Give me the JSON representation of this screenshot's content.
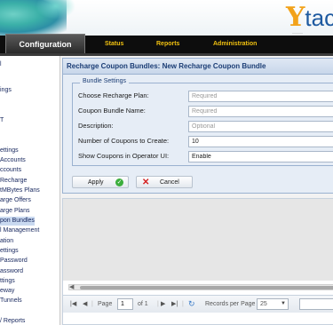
{
  "header": {
    "logo_y": "Y",
    "logo_rest": "tac",
    "logo_tagline": "———"
  },
  "topnav": {
    "tabs": [
      {
        "label": "Configuration",
        "active": true
      },
      {
        "label": "Status"
      },
      {
        "label": "Reports"
      },
      {
        "label": "Administration"
      }
    ]
  },
  "sidebar": {
    "items": [
      "l",
      "ings",
      "T",
      "ettings",
      " Accounts",
      "ccounts",
      "Recharge",
      "tMBytes Plans",
      "arge Offers",
      "arge Plans",
      "pon Bundles",
      "l Management",
      "ation",
      "ettings",
      "Password",
      "assword",
      "ttings",
      "eway",
      "Tunnels",
      "/ Reports"
    ],
    "selected_index": 10
  },
  "panel": {
    "title": "Recharge Coupon Bundles: New Recharge Coupon Bundle",
    "legend": "Bundle Settings",
    "fields": [
      {
        "label": "Choose Recharge Plan:",
        "value": "",
        "placeholder": "Required"
      },
      {
        "label": "Coupon Bundle Name:",
        "value": "",
        "placeholder": "Required"
      },
      {
        "label": "Description:",
        "value": "",
        "placeholder": "Optional"
      },
      {
        "label": "Number of Coupons to Create:",
        "value": "10",
        "placeholder": ""
      },
      {
        "label": "Show Coupons in Operator UI:",
        "value": "Enable",
        "placeholder": ""
      }
    ],
    "apply_label": "Apply",
    "cancel_label": "Cancel"
  },
  "pager": {
    "page_label": "Page",
    "page_value": "1",
    "of_label": "of 1",
    "records_label": "Records per Page",
    "records_value": "25"
  },
  "colors": {
    "nav_active_text": "#ffffff",
    "nav_text": "#f0c010",
    "panel_title": "#1b3d75",
    "logo_orange": "#f2a21a",
    "logo_blue": "#1e5aa0"
  }
}
